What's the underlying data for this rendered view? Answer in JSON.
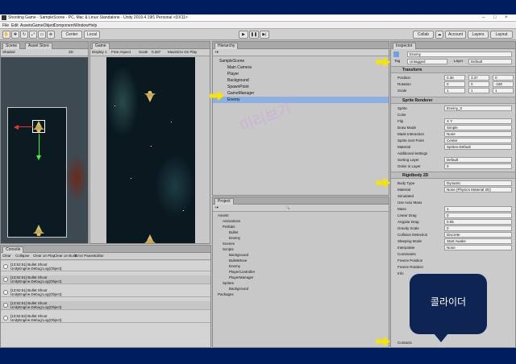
{
  "window": {
    "title": "Shooting Game - SampleScene - PC, Mac & Linux Standalone - Unity 2019.4.19f1 Personal <DX11>"
  },
  "menu": [
    "File",
    "Edit",
    "Assets",
    "GameObject",
    "Component",
    "Window",
    "Help"
  ],
  "toolbar": {
    "center": "Center",
    "local": "Local",
    "collab": "Collab",
    "account": "Account",
    "layers": "Layers",
    "layout": "Layout"
  },
  "scene_panel": {
    "tab_scene": "Scene",
    "tab_asset_store": "Asset Store",
    "shading": "Shaded",
    "mode": "2D"
  },
  "game_panel": {
    "tab": "Game",
    "display": "Display 1",
    "aspect": "Free Aspect",
    "scale_label": "Scale",
    "scale_value": "0.287",
    "maximize": "Maximize On Play"
  },
  "hierarchy": {
    "tab": "Hierarchy",
    "items": [
      "SampleScene",
      "Main Camera",
      "Player",
      "Background",
      "SpawnPoint",
      "GameManager",
      "Enemy"
    ],
    "selected": "Enemy"
  },
  "project": {
    "tab": "Project",
    "items": [
      "Assets",
      "Animations",
      "Prefabs",
      "Bullet",
      "Enemy",
      "Scenes",
      "Scripts",
      "Background",
      "BulletMove",
      "Enemy",
      "PlayerController",
      "PlayerManager",
      "Sprites",
      "Background",
      "Packages"
    ]
  },
  "watermark": "미리보기",
  "inspector": {
    "tab": "Inspector",
    "object_name": "Enemy",
    "tag_label": "Tag",
    "tag_value": "Untagged",
    "layer_label": "Layer",
    "layer_value": "Default",
    "transform": {
      "title": "Transform",
      "position": "Position",
      "rotation": "Rotation",
      "scale": "Scale",
      "px": "0.36",
      "py": "3.37",
      "pz": "0",
      "rx": "0",
      "ry": "0",
      "rz": "-180",
      "sx": "1",
      "sy": "1",
      "sz": "1"
    },
    "sprite_renderer": {
      "title": "Sprite Renderer",
      "rows": [
        [
          "Sprite",
          "Enemy_0"
        ],
        [
          "Color",
          ""
        ],
        [
          "Flip",
          "X  Y"
        ],
        [
          "Draw Mode",
          "Simple"
        ],
        [
          "Mask Interaction",
          "None"
        ],
        [
          "Sprite Sort Point",
          "Center"
        ],
        [
          "Material",
          "Sprites-Default"
        ],
        [
          "Additional Settings",
          ""
        ],
        [
          "Sorting Layer",
          "Default"
        ],
        [
          "Order in Layer",
          "0"
        ]
      ]
    },
    "rigidbody": {
      "title": "Rigidbody 2D",
      "rows": [
        [
          "Body Type",
          "Dynamic"
        ],
        [
          "Material",
          "None (Physics Material 2D)"
        ],
        [
          "Simulated",
          ""
        ],
        [
          "Use Auto Mass",
          ""
        ],
        [
          "Mass",
          "1"
        ],
        [
          "Linear Drag",
          "0"
        ],
        [
          "Angular Drag",
          "0.05"
        ],
        [
          "Gravity Scale",
          "0"
        ],
        [
          "Collision Detection",
          "Discrete"
        ],
        [
          "Sleeping Mode",
          "Start Awake"
        ],
        [
          "Interpolate",
          "None"
        ],
        [
          "Constraints",
          ""
        ],
        [
          "Freeze Position",
          ""
        ],
        [
          "Freeze Rotation",
          ""
        ],
        [
          "Info",
          ""
        ]
      ]
    },
    "footer": "Contacts"
  },
  "console": {
    "tab": "Console",
    "buttons": [
      "Clear",
      "Collapse",
      "Clear on Play",
      "Clear on Build",
      "Error Pause",
      "Editor"
    ],
    "rows": [
      {
        "time": "[13:52:51] Bullet Shoot",
        "detail": "UnityEngine.Debug:Log(Object)"
      },
      {
        "time": "[13:52:51] Bullet Shoot",
        "detail": "UnityEngine.Debug:Log(Object)"
      },
      {
        "time": "[13:52:51] Bullet Shoot",
        "detail": "UnityEngine.Debug:Log(Object)"
      },
      {
        "time": "[13:52:51] Bullet Shoot",
        "detail": "UnityEngine.Debug:Log(Object)"
      },
      {
        "time": "[13:52:52] Bullet Shoot",
        "detail": "UnityEngine.Debug:Log(Object)"
      }
    ]
  },
  "callout": {
    "text": "콜라이더"
  },
  "colors": {
    "frame": "#001e5e",
    "callout": "#0e2452",
    "arrow": "#f5e600",
    "selection": "#8eb0e0"
  }
}
